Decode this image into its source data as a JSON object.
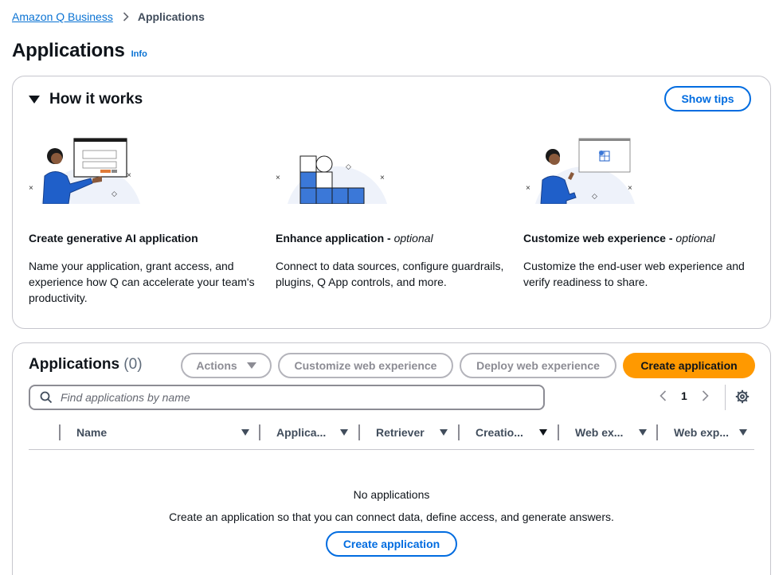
{
  "breadcrumb": {
    "root": "Amazon Q Business",
    "current": "Applications"
  },
  "page": {
    "title": "Applications",
    "info": "Info"
  },
  "how_it_works": {
    "title": "How it works",
    "show_tips": "Show tips",
    "steps": [
      {
        "title": "Create generative AI application",
        "optional": "",
        "desc": "Name your application, grant access, and experience how Q can accelerate your team's productivity."
      },
      {
        "title": "Enhance application - ",
        "optional": "optional",
        "desc": "Connect to data sources, configure guardrails, plugins, Q App controls, and more."
      },
      {
        "title": "Customize web experience - ",
        "optional": "optional",
        "desc": "Customize the end-user web experience and verify readiness to share."
      }
    ]
  },
  "applications": {
    "title": "Applications",
    "count": "(0)",
    "actions": "Actions",
    "customize": "Customize web experience",
    "deploy": "Deploy web experience",
    "create": "Create application",
    "search_placeholder": "Find applications by name",
    "page_number": "1",
    "columns": [
      "Name",
      "Applica...",
      "Retriever",
      "Creatio...",
      "Web ex...",
      "Web exp..."
    ],
    "empty_title": "No applications",
    "empty_desc": "Create an application so that you can connect data, define access, and generate answers.",
    "empty_button": "Create application"
  },
  "colors": {
    "link": "#0972d3",
    "primary": "#ff9900",
    "outline": "#006ce0",
    "illustration": "#1f5fc9"
  },
  "icons": [
    "chevron-right-icon",
    "caret-down-icon",
    "search-icon",
    "chevron-left-icon",
    "settings-gear-icon",
    "sort-icon"
  ]
}
